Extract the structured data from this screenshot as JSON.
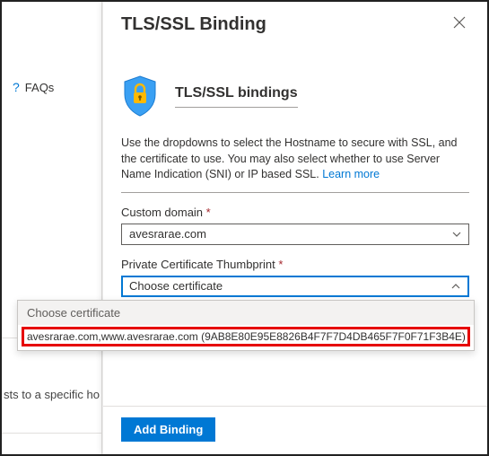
{
  "sidebar": {
    "faqs_label": "FAQs",
    "truncated_text": "sts to a specific ho"
  },
  "panel": {
    "title": "TLS/SSL Binding",
    "subtitle": "TLS/SSL bindings",
    "description_1": "Use the dropdowns to select the Hostname to secure with SSL, and the certificate to use. You may also select whether to use Server Name Indication (SNI) or IP based SSL. ",
    "learn_more": "Learn more",
    "custom_domain_label": "Custom domain",
    "custom_domain_value": "avesrarae.com",
    "cert_label": "Private Certificate Thumbprint",
    "cert_value": "Choose certificate",
    "dropdown": {
      "header": "Choose certificate",
      "option_1": "avesrarae.com,www.avesrarae.com (9AB8E80E95E8826B4F7F7D4DB465F7F0F71F3B4E)"
    },
    "add_button": "Add Binding"
  }
}
